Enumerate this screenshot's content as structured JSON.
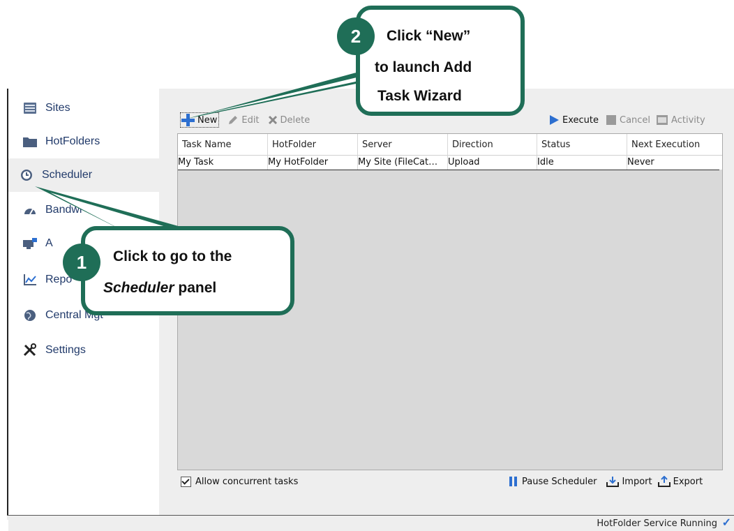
{
  "sidebar": {
    "items": [
      {
        "label": "Sites",
        "icon": "server-icon"
      },
      {
        "label": "HotFolders",
        "icon": "folder-icon"
      },
      {
        "label": "Scheduler",
        "icon": "clock-icon"
      },
      {
        "label": "Bandwi",
        "icon": "gauge-icon"
      },
      {
        "label": "A",
        "icon": "monitor-icon"
      },
      {
        "label": "Repo",
        "icon": "chart-icon"
      },
      {
        "label": "Central Mgt",
        "icon": "globe-icon"
      },
      {
        "label": "Settings",
        "icon": "tools-icon"
      }
    ],
    "active_index": 2
  },
  "toolbar": {
    "new_label": "New",
    "edit_label": "Edit",
    "delete_label": "Delete",
    "execute_label": "Execute",
    "cancel_label": "Cancel",
    "activity_label": "Activity"
  },
  "table": {
    "columns": [
      "Task Name",
      "HotFolder",
      "Server",
      "Direction",
      "Status",
      "Next Execution"
    ],
    "rows": [
      [
        "My Task",
        "My HotFolder",
        "My Site (FileCat…",
        "Upload",
        "Idle",
        "Never"
      ]
    ]
  },
  "footer": {
    "allow_concurrent_label": "Allow concurrent tasks",
    "allow_concurrent_checked": true,
    "pause_label": "Pause Scheduler",
    "import_label": "Import",
    "export_label": "Export"
  },
  "status": {
    "text": "HotFolder Service Running"
  },
  "callouts": {
    "step1": {
      "number": "1",
      "line1": "Click to go to the",
      "line2_italic": "Scheduler",
      "line2_rest": " panel"
    },
    "step2": {
      "number": "2",
      "line1": "Click “New”",
      "line2": "to launch Add",
      "line3": "Task Wizard"
    }
  },
  "colors": {
    "callout_green": "#1f6e57",
    "accent_blue": "#2d6fd0",
    "sidebar_text": "#213a6a"
  }
}
